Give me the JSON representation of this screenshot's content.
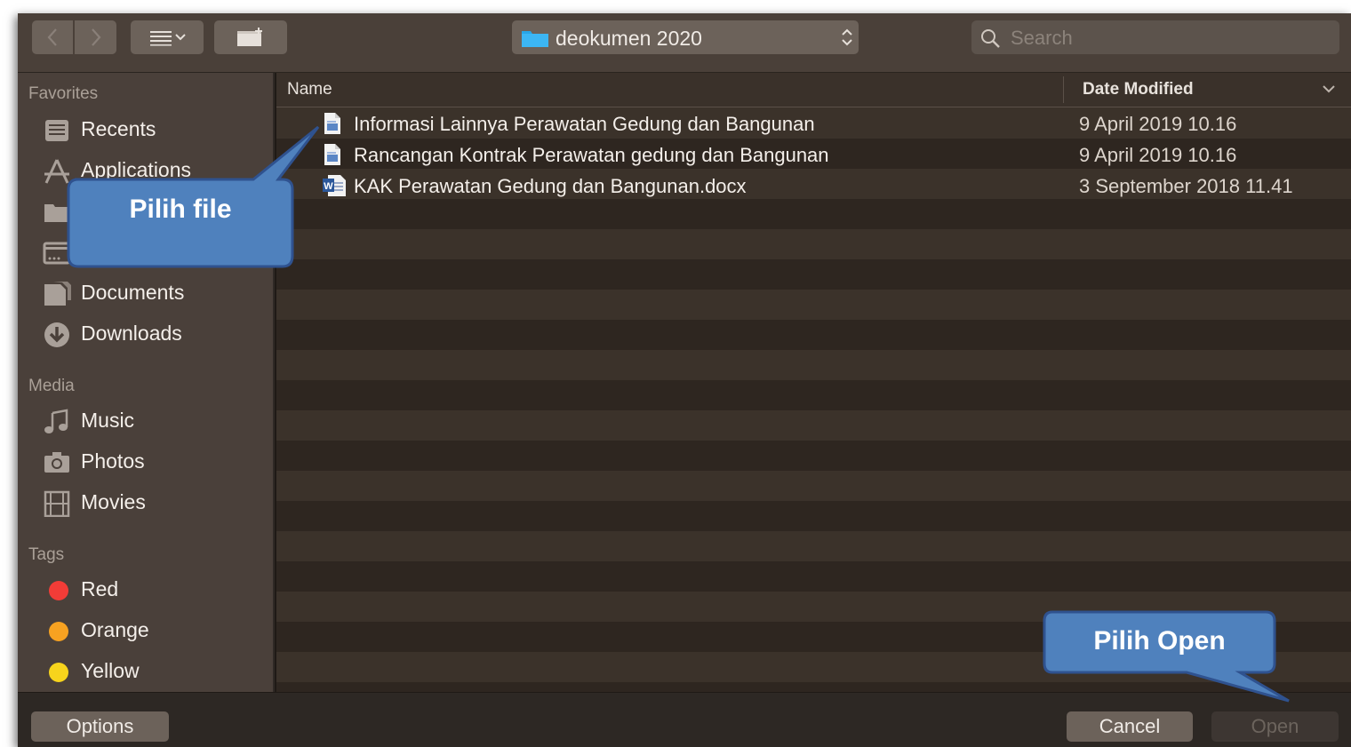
{
  "toolbar": {
    "path_label": "deokumen 2020",
    "search_placeholder": "Search"
  },
  "sidebar": {
    "favorites_heading": "Favorites",
    "favorites": [
      {
        "label": "Recents",
        "icon": "recents-icon"
      },
      {
        "label": "Applications",
        "icon": "applications-icon"
      },
      {
        "label": "",
        "icon": "folder-icon"
      },
      {
        "label": "",
        "icon": "disk-icon"
      },
      {
        "label": "Documents",
        "icon": "documents-icon"
      },
      {
        "label": "Downloads",
        "icon": "downloads-icon"
      }
    ],
    "media_heading": "Media",
    "media": [
      {
        "label": "Music",
        "icon": "music-icon"
      },
      {
        "label": "Photos",
        "icon": "camera-icon"
      },
      {
        "label": "Movies",
        "icon": "film-icon"
      }
    ],
    "tags_heading": "Tags",
    "tags": [
      {
        "label": "Red",
        "color": "#f23c37"
      },
      {
        "label": "Orange",
        "color": "#f7a221"
      },
      {
        "label": "Yellow",
        "color": "#f7d41c"
      }
    ]
  },
  "filelist": {
    "col_name": "Name",
    "col_date": "Date Modified",
    "rows": [
      {
        "name": "Informasi Lainnya Perawatan Gedung dan Bangunan",
        "date": "9 April 2019 10.16",
        "icon": "document-icon"
      },
      {
        "name": "Rancangan Kontrak Perawatan gedung dan Bangunan",
        "date": "9 April 2019 10.16",
        "icon": "document-icon"
      },
      {
        "name": "KAK Perawatan Gedung dan Bangunan.docx",
        "date": "3 September 2018 11.41",
        "icon": "word-document-icon"
      }
    ]
  },
  "buttons": {
    "options": "Options",
    "cancel": "Cancel",
    "open": "Open"
  },
  "callouts": {
    "pick_file": "Pilih file",
    "pick_open": "Pilih Open"
  },
  "colors": {
    "callout_fill": "#4f81bd",
    "callout_border": "#2f528f"
  }
}
